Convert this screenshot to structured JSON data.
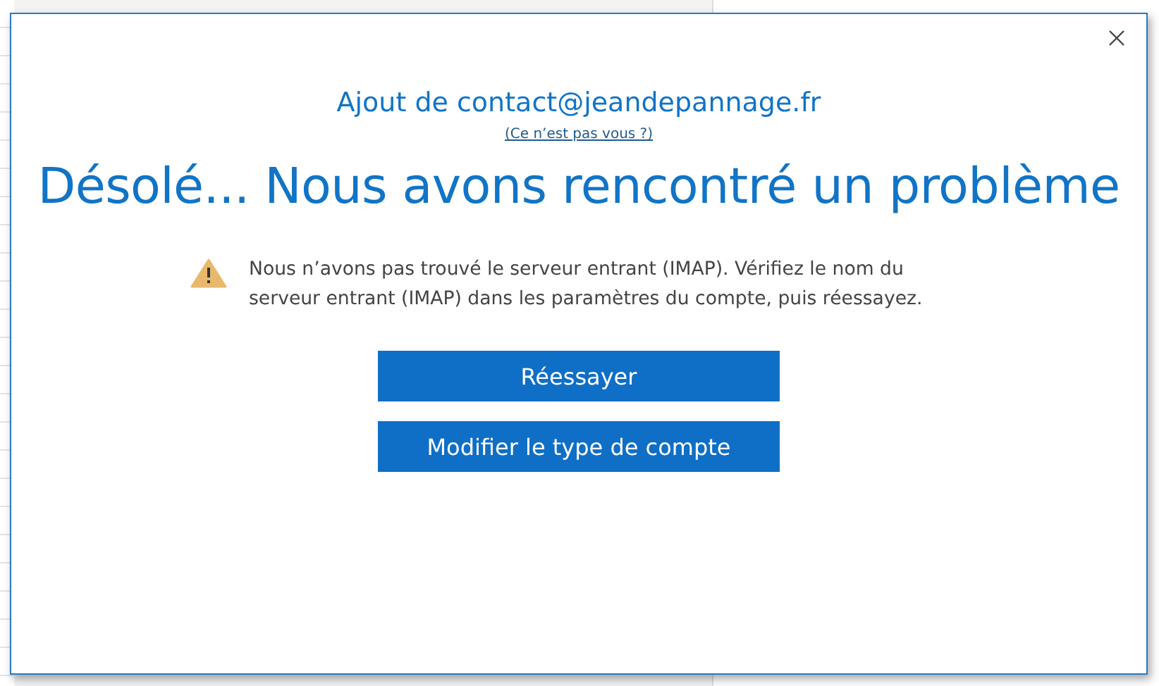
{
  "dialog": {
    "account_line": "Ajout de contact@jeandepannage.fr",
    "not_you_link": "(Ce n’est pas vous ?)",
    "heading": "Désolé... Nous avons rencontré un problème",
    "message": "Nous n’avons pas trouvé le serveur entrant (IMAP). Vérifiez le nom du serveur entrant (IMAP) dans les paramètres du compte, puis réessayez.",
    "buttons": [
      "Réessayer",
      "Modifier le type de compte"
    ]
  }
}
